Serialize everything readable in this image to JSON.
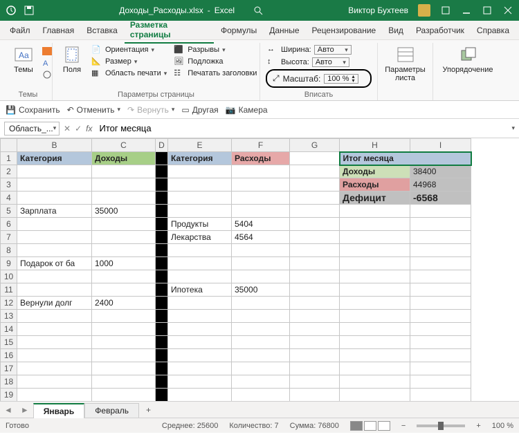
{
  "titlebar": {
    "filename": "Доходы_Расходы.xlsx",
    "app": "Excel",
    "user": "Виктор Бухтеев"
  },
  "menu": {
    "items": [
      "Файл",
      "Главная",
      "Вставка",
      "Разметка страницы",
      "Формулы",
      "Данные",
      "Рецензирование",
      "Вид",
      "Разработчик",
      "Справка"
    ],
    "active_index": 3
  },
  "ribbon": {
    "themes": {
      "btn": "Темы",
      "group": "Темы"
    },
    "page_setup": {
      "fields": "Поля",
      "orientation": "Ориентация",
      "size": "Размер",
      "print_area": "Область печати",
      "breaks": "Разрывы",
      "background": "Подложка",
      "print_titles": "Печатать заголовки",
      "group": "Параметры страницы"
    },
    "scale": {
      "width_lbl": "Ширина:",
      "width_val": "Авто",
      "height_lbl": "Высота:",
      "height_val": "Авто",
      "scale_lbl": "Масштаб:",
      "scale_val": "100 %",
      "group": "Вписать"
    },
    "sheet_params": {
      "btn": "Параметры\nлиста",
      "group": ""
    },
    "arrange": {
      "btn": "Упорядочение",
      "group": ""
    }
  },
  "qat": {
    "save": "Сохранить",
    "undo": "Отменить",
    "redo": "Вернуть",
    "other": "Другая",
    "camera": "Камера"
  },
  "formula_bar": {
    "name": "Область_...",
    "value": "Итог месяца"
  },
  "columns": [
    "B",
    "C",
    "D",
    "E",
    "F",
    "G",
    "H",
    "I"
  ],
  "rows": [
    "1",
    "2",
    "3",
    "4",
    "5",
    "6",
    "7",
    "8",
    "9",
    "10",
    "11",
    "12",
    "13",
    "14",
    "15",
    "16",
    "17",
    "18",
    "19"
  ],
  "sheet": {
    "B1": "Категория",
    "C1": "Доходы",
    "E1": "Категория",
    "F1": "Расходы",
    "B5": "Зарплата",
    "C5": "35000",
    "E6": "Продукты",
    "F6": "5404",
    "E7": "Лекарства",
    "F7": "4564",
    "B9": "Подарок от ба",
    "C9": "1000",
    "E11": "Ипотека",
    "F11": "35000",
    "B12": "Вернули долг",
    "C12": "2400",
    "summary_title": "Итог месяца",
    "H2": "Доходы",
    "I2": "38400",
    "H3": "Расходы",
    "I3": "44968",
    "H4": "Дефицит",
    "I4": "-6568"
  },
  "tabs": {
    "active": "Январь",
    "other": "Февраль"
  },
  "status": {
    "ready": "Готово",
    "avg_lbl": "Среднее:",
    "avg": "25600",
    "count_lbl": "Количество:",
    "count": "7",
    "sum_lbl": "Сумма:",
    "sum": "76800",
    "zoom": "100 %"
  }
}
